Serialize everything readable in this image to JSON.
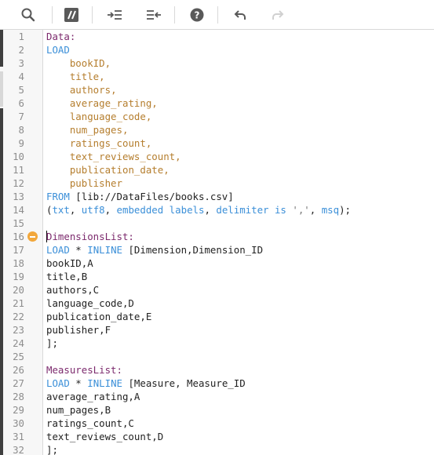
{
  "toolbar": {
    "buttons": [
      {
        "name": "search-button",
        "icon": "search-icon"
      },
      {
        "name": "comment-toggle-button",
        "icon": "comment-toggle-icon"
      },
      {
        "name": "indent-button",
        "icon": "indent-icon"
      },
      {
        "name": "outdent-button",
        "icon": "outdent-icon"
      },
      {
        "name": "help-button",
        "icon": "help-icon"
      },
      {
        "name": "undo-button",
        "icon": "undo-icon"
      },
      {
        "name": "redo-button",
        "icon": "redo-icon"
      }
    ]
  },
  "editor": {
    "fold_marker_line": "16",
    "lines": [
      {
        "n": "1",
        "segments": [
          {
            "t": "Data:",
            "c": "lbl"
          }
        ]
      },
      {
        "n": "2",
        "segments": [
          {
            "t": "LOAD",
            "c": "kw"
          }
        ]
      },
      {
        "n": "3",
        "segments": [
          {
            "t": "    ",
            "c": "txt"
          },
          {
            "t": "bookID",
            "c": "fld"
          },
          {
            "t": ",",
            "c": "fld"
          }
        ]
      },
      {
        "n": "4",
        "segments": [
          {
            "t": "    ",
            "c": "txt"
          },
          {
            "t": "title",
            "c": "fld"
          },
          {
            "t": ",",
            "c": "fld"
          }
        ]
      },
      {
        "n": "5",
        "segments": [
          {
            "t": "    ",
            "c": "txt"
          },
          {
            "t": "authors",
            "c": "fld"
          },
          {
            "t": ",",
            "c": "fld"
          }
        ]
      },
      {
        "n": "6",
        "segments": [
          {
            "t": "    ",
            "c": "txt"
          },
          {
            "t": "average_rating",
            "c": "fld"
          },
          {
            "t": ",",
            "c": "fld"
          }
        ]
      },
      {
        "n": "7",
        "segments": [
          {
            "t": "    ",
            "c": "txt"
          },
          {
            "t": "language_code",
            "c": "fld"
          },
          {
            "t": ",",
            "c": "fld"
          }
        ]
      },
      {
        "n": "8",
        "segments": [
          {
            "t": "    ",
            "c": "txt"
          },
          {
            "t": "num_pages",
            "c": "fld"
          },
          {
            "t": ",",
            "c": "fld"
          }
        ]
      },
      {
        "n": "9",
        "segments": [
          {
            "t": "    ",
            "c": "txt"
          },
          {
            "t": "ratings_count",
            "c": "fld"
          },
          {
            "t": ",",
            "c": "fld"
          }
        ]
      },
      {
        "n": "10",
        "segments": [
          {
            "t": "    ",
            "c": "txt"
          },
          {
            "t": "text_reviews_count",
            "c": "fld"
          },
          {
            "t": ",",
            "c": "fld"
          }
        ]
      },
      {
        "n": "11",
        "segments": [
          {
            "t": "    ",
            "c": "txt"
          },
          {
            "t": "publication_date",
            "c": "fld"
          },
          {
            "t": ",",
            "c": "fld"
          }
        ]
      },
      {
        "n": "12",
        "segments": [
          {
            "t": "    ",
            "c": "txt"
          },
          {
            "t": "publisher",
            "c": "fld"
          }
        ]
      },
      {
        "n": "13",
        "segments": [
          {
            "t": "FROM",
            "c": "kw"
          },
          {
            "t": " [lib://DataFiles/books.csv]",
            "c": "txt"
          }
        ]
      },
      {
        "n": "14",
        "segments": [
          {
            "t": "(",
            "c": "txt"
          },
          {
            "t": "txt",
            "c": "kw"
          },
          {
            "t": ", ",
            "c": "txt"
          },
          {
            "t": "utf8",
            "c": "kw"
          },
          {
            "t": ", ",
            "c": "txt"
          },
          {
            "t": "embedded labels",
            "c": "kw"
          },
          {
            "t": ", ",
            "c": "txt"
          },
          {
            "t": "delimiter is",
            "c": "kw"
          },
          {
            "t": " ",
            "c": "txt"
          },
          {
            "t": "','",
            "c": "str"
          },
          {
            "t": ", ",
            "c": "txt"
          },
          {
            "t": "msq",
            "c": "kw"
          },
          {
            "t": ");",
            "c": "txt"
          }
        ]
      },
      {
        "n": "15",
        "segments": []
      },
      {
        "n": "16",
        "segments": [
          {
            "t": "DimensionsList:",
            "c": "lbl"
          }
        ]
      },
      {
        "n": "17",
        "segments": [
          {
            "t": "LOAD",
            "c": "kw"
          },
          {
            "t": " * ",
            "c": "txt"
          },
          {
            "t": "INLINE",
            "c": "kw"
          },
          {
            "t": " [Dimension,Dimension_ID",
            "c": "txt"
          }
        ]
      },
      {
        "n": "18",
        "segments": [
          {
            "t": "bookID,A",
            "c": "txt"
          }
        ]
      },
      {
        "n": "19",
        "segments": [
          {
            "t": "title,B",
            "c": "txt"
          }
        ]
      },
      {
        "n": "20",
        "segments": [
          {
            "t": "authors,C",
            "c": "txt"
          }
        ]
      },
      {
        "n": "21",
        "segments": [
          {
            "t": "language_code,D",
            "c": "txt"
          }
        ]
      },
      {
        "n": "22",
        "segments": [
          {
            "t": "publication_date,E",
            "c": "txt"
          }
        ]
      },
      {
        "n": "23",
        "segments": [
          {
            "t": "publisher,F",
            "c": "txt"
          }
        ]
      },
      {
        "n": "24",
        "segments": [
          {
            "t": "];",
            "c": "txt"
          }
        ]
      },
      {
        "n": "25",
        "segments": []
      },
      {
        "n": "26",
        "segments": [
          {
            "t": "MeasuresList:",
            "c": "lbl"
          }
        ]
      },
      {
        "n": "27",
        "segments": [
          {
            "t": "LOAD",
            "c": "kw"
          },
          {
            "t": " * ",
            "c": "txt"
          },
          {
            "t": "INLINE",
            "c": "kw"
          },
          {
            "t": " [Measure, Measure_ID",
            "c": "txt"
          }
        ]
      },
      {
        "n": "28",
        "segments": [
          {
            "t": "average_rating,A",
            "c": "txt"
          }
        ]
      },
      {
        "n": "29",
        "segments": [
          {
            "t": "num_pages,B",
            "c": "txt"
          }
        ]
      },
      {
        "n": "30",
        "segments": [
          {
            "t": "ratings_count,C",
            "c": "txt"
          }
        ]
      },
      {
        "n": "31",
        "segments": [
          {
            "t": "text_reviews_count,D",
            "c": "txt"
          }
        ]
      },
      {
        "n": "32",
        "segments": [
          {
            "t": "];",
            "c": "txt"
          }
        ]
      }
    ]
  }
}
